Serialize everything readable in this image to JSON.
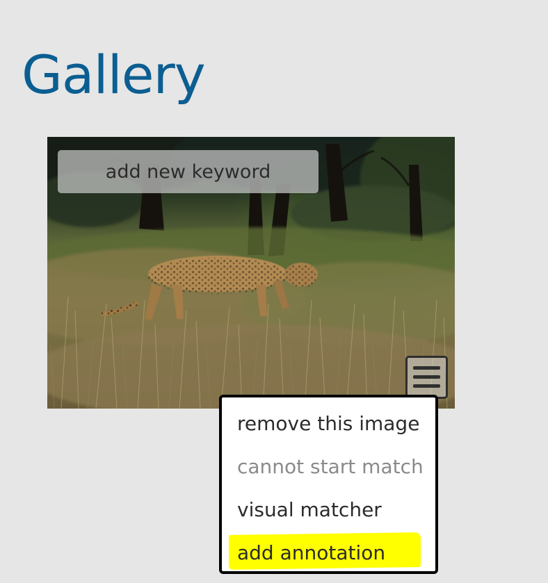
{
  "page": {
    "title": "Gallery"
  },
  "image_card": {
    "keyword_input": {
      "placeholder": "add new keyword",
      "value": ""
    },
    "menu_button_icon": "hamburger-menu-icon"
  },
  "context_menu": {
    "items": [
      {
        "label": "remove this image",
        "enabled": true
      },
      {
        "label": "cannot start match",
        "enabled": false
      },
      {
        "label": "visual matcher",
        "enabled": true
      },
      {
        "label": "add annotation",
        "enabled": true,
        "highlighted": true
      }
    ]
  },
  "colors": {
    "background": "#e6e6e6",
    "title": "#0b5e91",
    "highlight": "#ffff00",
    "menu_border": "#000000",
    "disabled_text": "#8a8a8a"
  }
}
